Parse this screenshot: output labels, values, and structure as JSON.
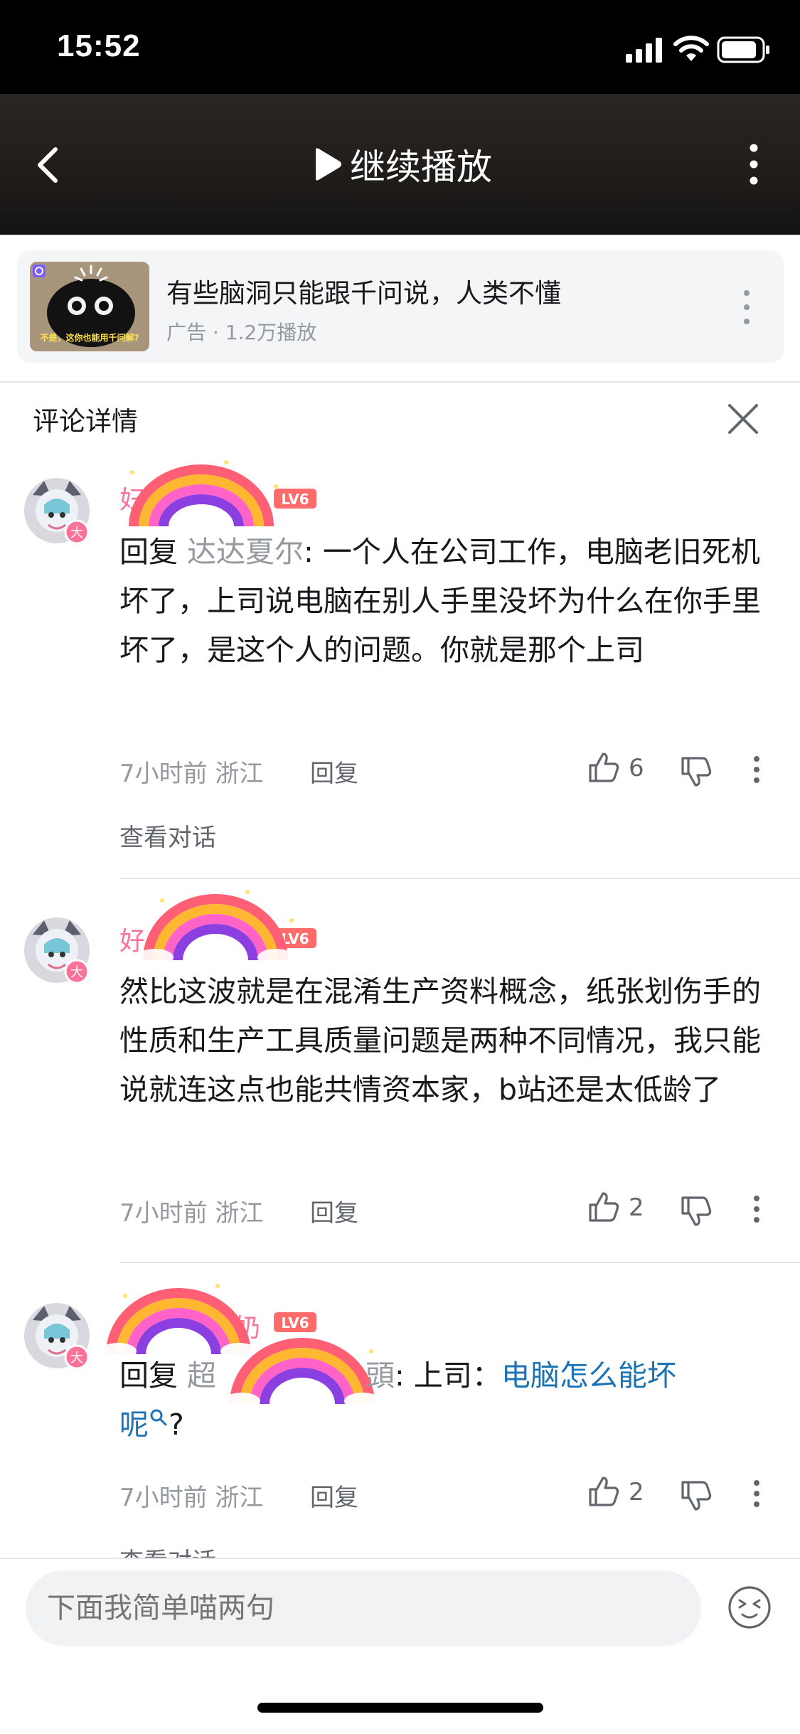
{
  "status_bar": {
    "time": "15:52"
  },
  "header": {
    "title": "继续播放"
  },
  "ad": {
    "thumb_caption": "不是，这你也能用千问解?",
    "title": "有些脑洞只能跟千问说，人类不懂",
    "meta": "广告 · 1.2万播放"
  },
  "comments_panel": {
    "title": "评论详情"
  },
  "comments": [
    {
      "username": "妇",
      "level": "LV6",
      "reply_prefix": "回复",
      "reply_to": "达达夏尔",
      "text": ": 一个人在公司工作，电脑老旧死机坏了，上司说电脑在别人手里没坏为什么在你手里坏了，是这个人的问题。你就是那个上司",
      "time": "7小时前",
      "location": "浙江",
      "reply_label": "回复",
      "likes": "6",
      "view_conversation": "查看对话"
    },
    {
      "username": "好",
      "level": "LV6",
      "text": "然比这波就是在混淆生产资料概念，纸张划伤手的性质和生产工具质量问题是两种不同情况，我只能说就连这点也能共情资本家，b站还是太低龄了",
      "time": "7小时前",
      "location": "浙江",
      "reply_label": "回复",
      "likes": "2"
    },
    {
      "username": "奶",
      "level": "LV6",
      "reply_prefix": "回复",
      "reply_to": "超",
      "reply_to_tail": "頭",
      "text": ": 上司：",
      "link_text": "电脑怎么能坏呢",
      "suffix": "?",
      "time": "7小时前",
      "location": "浙江",
      "reply_label": "回复",
      "likes": "2",
      "view_conversation": "查看对话"
    }
  ],
  "input": {
    "placeholder": "下面我简单喵两句"
  },
  "colors": {
    "brand_pink": "#fb7299",
    "link_blue": "#1b73b6",
    "muted": "#9499a0"
  }
}
